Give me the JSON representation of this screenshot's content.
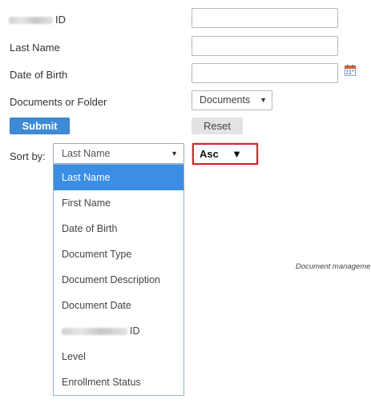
{
  "form": {
    "fields": [
      {
        "label_suffix": "ID",
        "value": ""
      },
      {
        "label": "Last Name",
        "value": ""
      },
      {
        "label": "Date of Birth",
        "value": ""
      },
      {
        "label": "Documents or Folder",
        "selected": "Documents"
      }
    ],
    "calendar_icon": "calendar-icon",
    "buttons": {
      "submit": "Submit",
      "reset": "Reset"
    },
    "sort": {
      "label": "Sort by:",
      "field_selected": "Last Name",
      "direction_selected": "Asc",
      "options": [
        {
          "label": "Last Name"
        },
        {
          "label": "First Name"
        },
        {
          "label": "Date of Birth"
        },
        {
          "label": "Document Type"
        },
        {
          "label": "Document Description"
        },
        {
          "label": "Document Date"
        },
        {
          "label_suffix": "ID"
        },
        {
          "label": "Level"
        },
        {
          "label": "Enrollment Status"
        }
      ],
      "highlighted_index": 0
    }
  },
  "footer": {
    "text": "Document manageme"
  },
  "colors": {
    "submit_bg": "#3e8ad6",
    "highlight_bg": "#3b8ee4",
    "focus_border": "#d3252b"
  }
}
